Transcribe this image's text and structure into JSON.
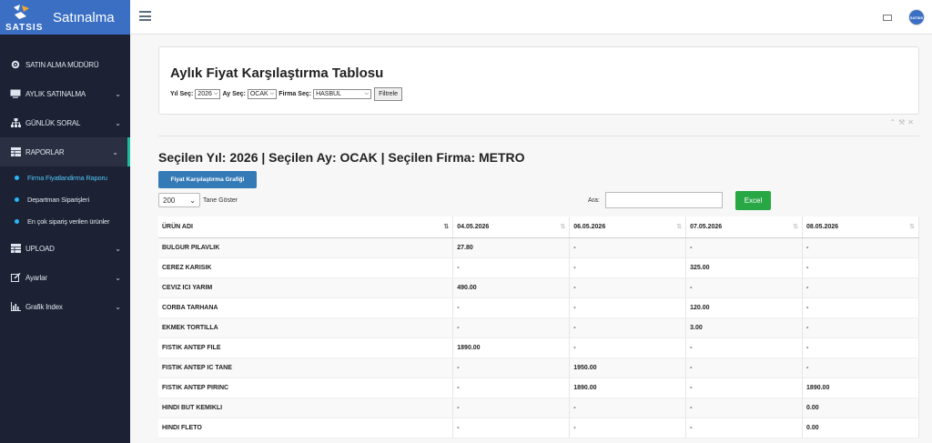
{
  "app": {
    "logo_text": "SATSIS",
    "title": "Satınalma",
    "avatar_text": "SATSIS"
  },
  "sidebar": {
    "items": [
      {
        "label": "SATIN ALMA MÜDÜRÜ",
        "icon": "gear-icon",
        "has_chevron": false
      },
      {
        "label": "AYLIK SATINALMA",
        "icon": "monitor-icon",
        "has_chevron": true
      },
      {
        "label": "GÜNLÜK SORAL",
        "icon": "sitemap-icon",
        "has_chevron": true
      },
      {
        "label": "RAPORLAR",
        "icon": "table-icon",
        "has_chevron": true,
        "active": true
      }
    ],
    "sub_items": [
      {
        "label": "Firma Fiyatlandirma Raporu"
      },
      {
        "label": "Departman Siparişleri"
      },
      {
        "label": "En çok sipariş verilen ürünler"
      }
    ],
    "items_after": [
      {
        "label": "UPLOAD",
        "icon": "table-icon"
      },
      {
        "label": "Ayarlar",
        "icon": "edit-icon"
      },
      {
        "label": "Grafik Index",
        "icon": "bar-chart-icon"
      }
    ]
  },
  "filter_panel": {
    "title": "Aylık Fiyat Karşılaştırma Tablosu",
    "year_label": "Yıl Seç:",
    "year_value": "2026",
    "month_label": "Ay Seç:",
    "month_value": "OCAK",
    "firm_label": "Firma Seç:",
    "firm_value": "HASBUL",
    "filter_button": "Filtrele"
  },
  "selection_title": "Seçilen Yıl: 2026 | Seçilen Ay: OCAK | Seçilen Firma: METRO",
  "chart_button": "Fiyat Karşılaştırma Grafiği",
  "length": {
    "value": "200",
    "label": "Tane Göster"
  },
  "search": {
    "label": "Ara:",
    "value": ""
  },
  "excel_button": "Excel",
  "table": {
    "headers": [
      "ÜRÜN ADI",
      "04.05.2026",
      "06.05.2026",
      "07.05.2026",
      "08.05.2026"
    ],
    "rows": [
      [
        "BULGUR PILAVLIK",
        "27.80",
        "-",
        "-",
        "-"
      ],
      [
        "CEREZ KARISIK",
        "-",
        "-",
        "325.00",
        "-"
      ],
      [
        "CEVIZ ICI YARIM",
        "490.00",
        "-",
        "-",
        "-"
      ],
      [
        "CORBA TARHANA",
        "-",
        "-",
        "120.00",
        "-"
      ],
      [
        "EKMEK TORTILLA",
        "-",
        "-",
        "3.00",
        "-"
      ],
      [
        "FISTIK ANTEP FILE",
        "1890.00",
        "-",
        "-",
        "-"
      ],
      [
        "FISTIK ANTEP IC TANE",
        "-",
        "1950.00",
        "-",
        "-"
      ],
      [
        "FISTIK ANTEP PIRINC",
        "-",
        "1890.00",
        "-",
        "1890.00"
      ],
      [
        "HINDI BUT KEMIKLI",
        "-",
        "-",
        "-",
        "0.00"
      ],
      [
        "HINDI FLETO",
        "-",
        "-",
        "-",
        "0.00"
      ]
    ]
  }
}
